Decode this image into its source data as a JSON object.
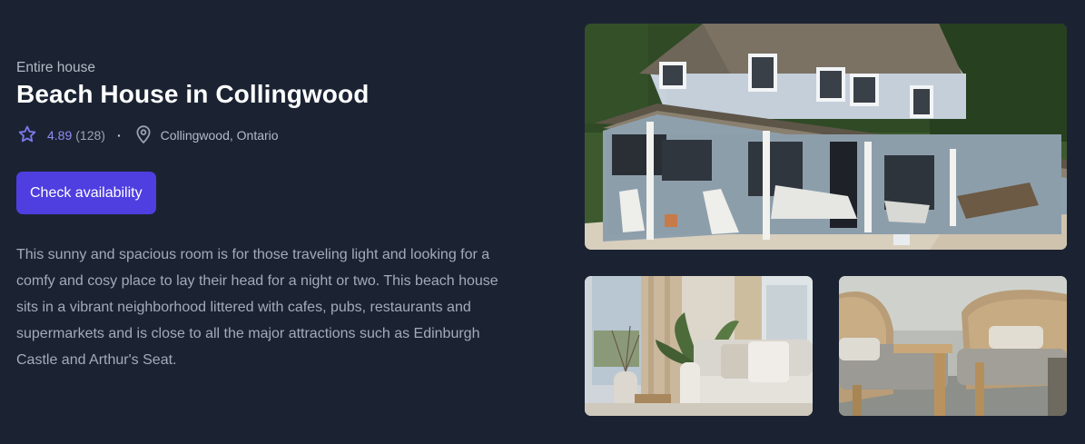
{
  "listing": {
    "type": "Entire house",
    "title": "Beach House in Collingwood",
    "rating": "4.89",
    "reviews": "(128)",
    "separator": "·",
    "location": "Collingwood, Ontario",
    "cta_label": "Check availability",
    "description": "This sunny and spacious room is for those traveling light and looking for a comfy and cosy place to lay their head for a night or two. This beach house sits in a vibrant neighborhood littered with cafes, pubs, restaurants and supermarkets and is close to all the major attractions such as Edinburgh Castle and Arthur's Seat."
  },
  "icons": {
    "rating": "star-icon",
    "location": "map-pin-icon"
  },
  "colors": {
    "background": "#1b2333",
    "accent": "#4f3ee0",
    "rating_text": "#8e8cf2"
  }
}
